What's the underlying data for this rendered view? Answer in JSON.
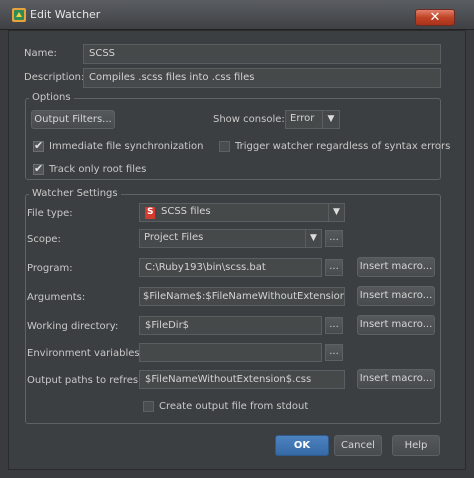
{
  "window": {
    "title": "Edit Watcher",
    "close_glyph": "✕",
    "icon": "watcher-app-icon"
  },
  "form": {
    "name_label": "Name:",
    "name_value": "SCSS",
    "description_label": "Description:",
    "description_value": "Compiles .scss files into .css files"
  },
  "options": {
    "title": "Options",
    "output_filters_label": "Output Filters...",
    "show_console_label": "Show console:",
    "show_console_value": "Error",
    "immediate_sync_label": "Immediate file synchronization",
    "immediate_sync_checked": true,
    "trigger_regardless_label": "Trigger watcher regardless of syntax errors",
    "trigger_regardless_checked": false,
    "track_root_label": "Track only root files",
    "track_root_checked": true
  },
  "watcher_settings": {
    "title": "Watcher Settings",
    "file_type_label": "File type:",
    "file_type_value": "SCSS files",
    "file_type_icon": "scss-file-icon",
    "scope_label": "Scope:",
    "scope_value": "Project Files",
    "program_label": "Program:",
    "program_value": "C:\\Ruby193\\bin\\scss.bat",
    "arguments_label": "Arguments:",
    "arguments_value": "$FileName$:$FileNameWithoutExtension$.css",
    "working_dir_label": "Working directory:",
    "working_dir_value": "$FileDir$",
    "env_vars_label": "Environment variables:",
    "env_vars_value": "",
    "output_paths_label": "Output paths to refresh:",
    "output_paths_value": "$FileNameWithoutExtension$.css",
    "insert_macro_label": "Insert macro...",
    "ellipsis_label": "...",
    "create_output_label": "Create output file from stdout",
    "create_output_checked": false
  },
  "buttons": {
    "ok": "OK",
    "cancel": "Cancel",
    "help": "Help"
  },
  "colors": {
    "accent_blue": "#3d6ea8",
    "close_red": "#c04426",
    "window_bg": "#3c3f41"
  }
}
